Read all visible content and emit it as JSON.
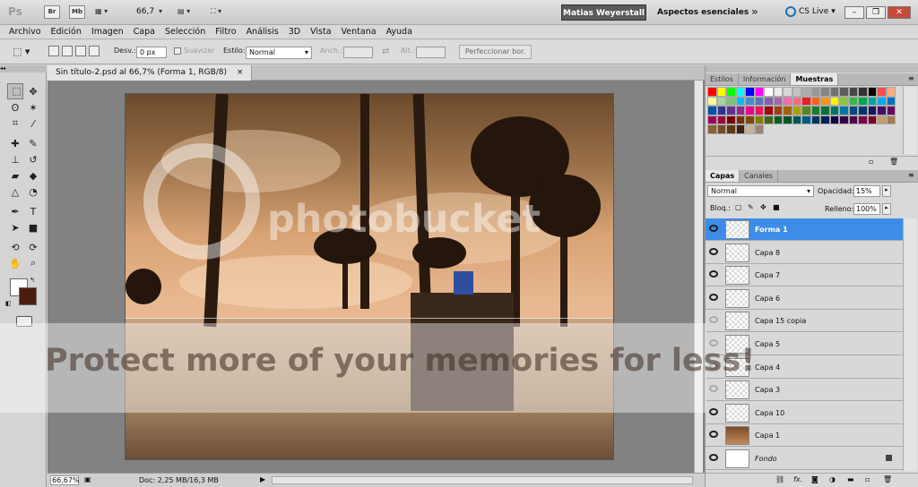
{
  "appbar": {
    "logo": "Ps",
    "br_label": "Br",
    "mb_label": "Mb",
    "zoom": "66,7",
    "workspace_active": "Matias Weyerstall",
    "workspace_other": "Aspectos esenciales",
    "chevron": "»",
    "cslive": "CS Live",
    "win_min": "–",
    "win_restore": "❐",
    "win_close": "✕"
  },
  "menu": [
    "Archivo",
    "Edición",
    "Imagen",
    "Capa",
    "Selección",
    "Filtro",
    "Análisis",
    "3D",
    "Vista",
    "Ventana",
    "Ayuda"
  ],
  "options": {
    "desv_label": "Desv.:",
    "desv_value": "0 px",
    "suavizar_label": "Suavizar",
    "estilo_label": "Estilo:",
    "estilo_value": "Normal",
    "anch_label": "Anch.:",
    "alt_label": "Alt.:",
    "perfeccionar": "Perfeccionar bor."
  },
  "document": {
    "tab_title": "Sin título-2.psd al 66,7% (Forma 1, RGB/8)",
    "tab_close": "×",
    "zoom_field": "66,67%",
    "doc_info": "Doc: 2,25 MB/16,3 MB",
    "status_arrow": "▶"
  },
  "watermark": {
    "brand": "photobucket",
    "slogan": "Protect more of your memories for less!"
  },
  "swatches_panel": {
    "tabs": [
      "Estilos",
      "Información",
      "Muestras"
    ],
    "active_tab": "Muestras"
  },
  "swatches": [
    "#ff0000",
    "#ffff00",
    "#00ff00",
    "#00ffff",
    "#0000ff",
    "#ff00ff",
    "#ffffff",
    "#ebebeb",
    "#d6d6d6",
    "#c2c2c2",
    "#adadad",
    "#999999",
    "#858585",
    "#707070",
    "#5c5c5c",
    "#474747",
    "#333333",
    "#000000",
    "#f24f4f",
    "#f9ad81",
    "#fff799",
    "#a3d39c",
    "#7cc576",
    "#00bff3",
    "#448ccb",
    "#5674b9",
    "#8560a8",
    "#a864a8",
    "#f06eaa",
    "#f26d7d",
    "#ed1c24",
    "#f26522",
    "#f7941d",
    "#fff200",
    "#8dc63f",
    "#39b54a",
    "#00a651",
    "#00a99d",
    "#00aeef",
    "#0072bc",
    "#0054a6",
    "#2e3192",
    "#662d91",
    "#92278f",
    "#ec008c",
    "#ed145b",
    "#9e0b0f",
    "#a0410d",
    "#a36209",
    "#aba000",
    "#598527",
    "#197b30",
    "#007236",
    "#00746b",
    "#0076a3",
    "#004a80",
    "#003471",
    "#1b1464",
    "#440e62",
    "#630460",
    "#9e005d",
    "#9e0039",
    "#790000",
    "#7b2e00",
    "#7d4900",
    "#827b00",
    "#406618",
    "#005e20",
    "#005826",
    "#005952",
    "#005b7f",
    "#003663",
    "#002157",
    "#0d004c",
    "#32004b",
    "#4b0049",
    "#7b0046",
    "#7a0026",
    "#c69c6d",
    "#a67c52",
    "#8c6239",
    "#754c24",
    "#603913",
    "#3c2415",
    "#c7b299",
    "#998675"
  ],
  "layers_panel": {
    "tabs": [
      "Capas",
      "Canales"
    ],
    "active_tab": "Capas",
    "blend_mode": "Normal",
    "opacity_label": "Opacidad:",
    "opacity_value": "15%",
    "lock_label": "Bloq.:",
    "fill_label": "Relleno:",
    "fill_value": "100%"
  },
  "layers": [
    {
      "name": "Forma 1",
      "visible": true,
      "thumb": "checker",
      "selected": true
    },
    {
      "name": "Capa 8",
      "visible": true,
      "thumb": "checker",
      "selected": false
    },
    {
      "name": "Capa 7",
      "visible": true,
      "thumb": "checker",
      "selected": false
    },
    {
      "name": "Capa 6",
      "visible": true,
      "thumb": "checker",
      "selected": false
    },
    {
      "name": "Capa 15 copia",
      "visible": false,
      "thumb": "checker",
      "selected": false
    },
    {
      "name": "Capa 5",
      "visible": false,
      "thumb": "checker",
      "selected": false
    },
    {
      "name": "Capa 4",
      "visible": false,
      "thumb": "checker",
      "selected": false
    },
    {
      "name": "Capa 3",
      "visible": false,
      "thumb": "checker",
      "selected": false
    },
    {
      "name": "Capa 10",
      "visible": true,
      "thumb": "checker",
      "selected": false
    },
    {
      "name": "Capa 1",
      "visible": true,
      "thumb": "image",
      "selected": false
    },
    {
      "name": "Fondo",
      "visible": true,
      "thumb": "white",
      "selected": false,
      "locked": true
    }
  ],
  "colors": {
    "foreground": "#ffffff",
    "background": "#4a1d10",
    "selected_layer": "#3d8de8"
  }
}
